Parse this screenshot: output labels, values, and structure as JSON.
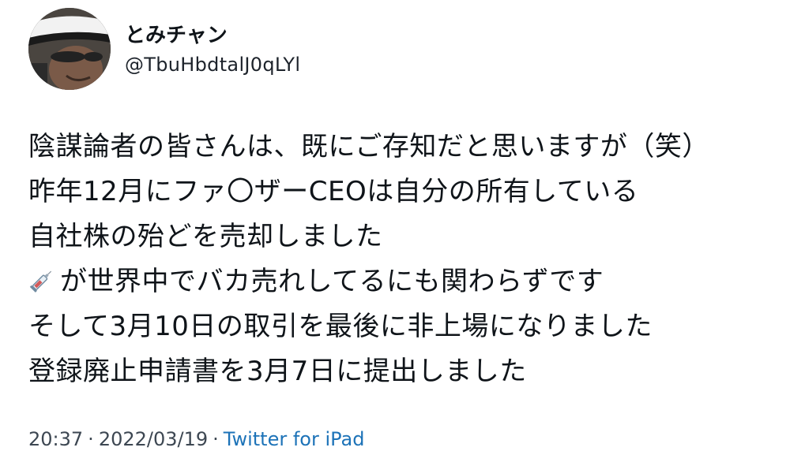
{
  "author": {
    "display_name": "とみチャン",
    "handle": "@TbuHbdtalJ0qLYl",
    "avatar_icon": "profile-photo-man-white-hat"
  },
  "tweet": {
    "lines": [
      "陰謀論者の皆さんは、既にご存知だと思いますが（笑）",
      "昨年12月にファ〇ザーCEOは自分の所有している",
      "自社株の殆どを売却しました",
      "が世界中でバカ売れしてるにも関わらずです",
      "そして3月10日の取引を最後に非上場になりました",
      "登録廃止申請書を3月7日に提出しました"
    ],
    "inline_emoji": "syringe-icon"
  },
  "meta": {
    "time": "20:37",
    "separator": "·",
    "date": "2022/03/19",
    "source": "Twitter for iPad"
  },
  "colors": {
    "text": "#0f1419",
    "meta_text": "#3d4752",
    "link": "#1d73b8",
    "background": "#ffffff"
  }
}
